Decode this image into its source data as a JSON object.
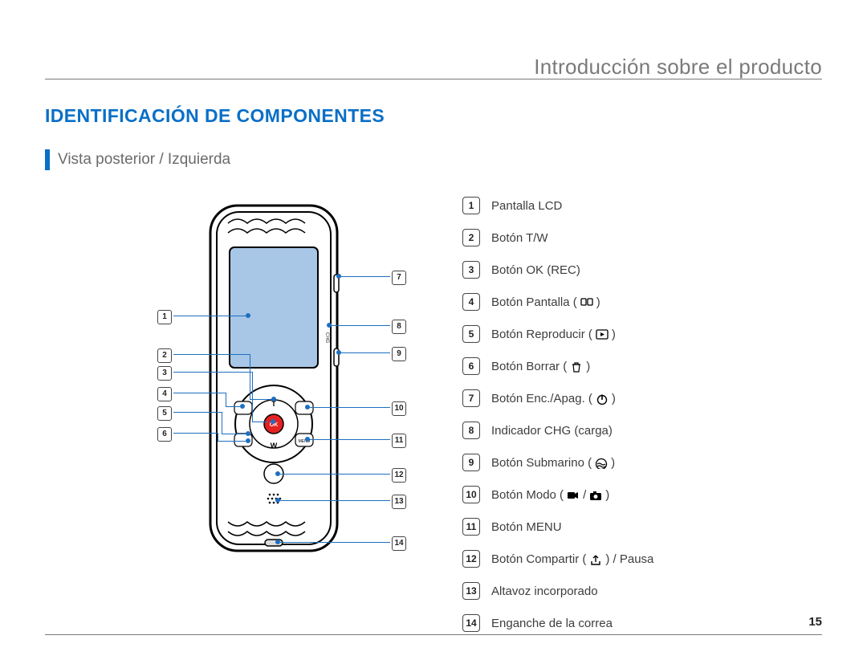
{
  "chapter_title": "Introducción sobre el producto",
  "section_title": "IDENTIFICACIÓN DE COMPONENTES",
  "view_label": "Vista posterior / Izquierda",
  "page_number": "15",
  "device_buttons": {
    "ok": "OK",
    "menu": "MENU",
    "t": "T",
    "w": "W",
    "chg": "CHG"
  },
  "left_callouts": [
    "1",
    "2",
    "3",
    "4",
    "5",
    "6"
  ],
  "right_callouts": [
    "7",
    "8",
    "9",
    "10",
    "11",
    "12",
    "13",
    "14"
  ],
  "legend": [
    {
      "num": "1",
      "text": "Pantalla LCD",
      "icons": []
    },
    {
      "num": "2",
      "text": "Botón T/W",
      "icons": []
    },
    {
      "num": "3",
      "text": "Botón OK (REC)",
      "icons": []
    },
    {
      "num": "4",
      "text": "Botón Pantalla (",
      "icons": [
        "display"
      ],
      "text_after": ")"
    },
    {
      "num": "5",
      "text": "Botón Reproducir (",
      "icons": [
        "play"
      ],
      "text_after": ")"
    },
    {
      "num": "6",
      "text": "Botón Borrar (",
      "icons": [
        "trash"
      ],
      "text_after": ")"
    },
    {
      "num": "7",
      "text": "Botón Enc./Apag. (",
      "icons": [
        "power"
      ],
      "text_after": ")"
    },
    {
      "num": "8",
      "text": "Indicador CHG (carga)",
      "icons": []
    },
    {
      "num": "9",
      "text": "Botón Submarino (",
      "icons": [
        "underwater"
      ],
      "text_after": ")"
    },
    {
      "num": "10",
      "text": "Botón Modo (",
      "icons": [
        "video",
        "slash",
        "camera"
      ],
      "text_after": ")"
    },
    {
      "num": "11",
      "text": "Botón MENU",
      "icons": []
    },
    {
      "num": "12",
      "text": "Botón Compartir (",
      "icons": [
        "share"
      ],
      "text_after": ") / Pausa"
    },
    {
      "num": "13",
      "text": "Altavoz incorporado",
      "icons": []
    },
    {
      "num": "14",
      "text": "Enganche de la correa",
      "icons": []
    }
  ],
  "icons": {
    "display": "display-icon",
    "play": "play-icon",
    "trash": "trash-icon",
    "power": "power-icon",
    "underwater": "underwater-icon",
    "video": "video-icon",
    "camera": "camera-icon",
    "share": "share-icon",
    "slash": "slash"
  }
}
